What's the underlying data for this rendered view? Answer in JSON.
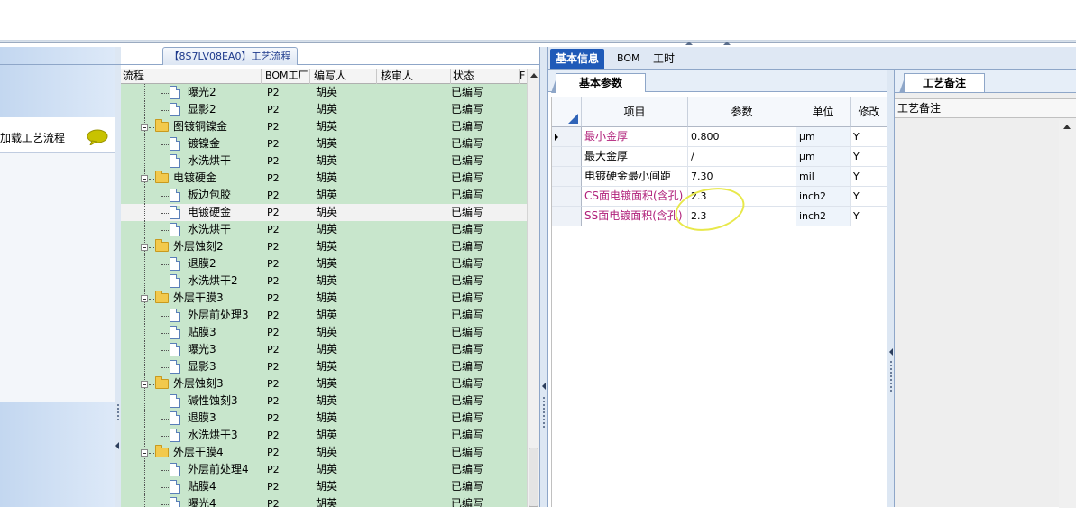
{
  "left_pane": {
    "load_flow_label": "加载工艺流程",
    "load_flow_icon": "speech-bubble-icon"
  },
  "process_tab": {
    "label": "【8S7LV08EA0】工艺流程"
  },
  "tree_grid": {
    "columns": [
      "流程",
      "BOM工厂",
      "编写人",
      "核审人",
      "状态",
      "F"
    ],
    "rows": [
      {
        "name": "曝光2",
        "type": "doc",
        "level": 2,
        "bom": "P2",
        "author": "胡英",
        "reviewer": "",
        "status": "已编写"
      },
      {
        "name": "显影2",
        "type": "doc",
        "level": 2,
        "bom": "P2",
        "author": "胡英",
        "reviewer": "",
        "status": "已编写"
      },
      {
        "name": "图镀铜镍金",
        "type": "folder",
        "level": 1,
        "bom": "P2",
        "author": "胡英",
        "reviewer": "",
        "status": "已编写"
      },
      {
        "name": "镀镍金",
        "type": "doc",
        "level": 2,
        "bom": "P2",
        "author": "胡英",
        "reviewer": "",
        "status": "已编写"
      },
      {
        "name": "水洗烘干",
        "type": "doc",
        "level": 2,
        "bom": "P2",
        "author": "胡英",
        "reviewer": "",
        "status": "已编写"
      },
      {
        "name": "电镀硬金",
        "type": "folder",
        "level": 1,
        "bom": "P2",
        "author": "胡英",
        "reviewer": "",
        "status": "已编写"
      },
      {
        "name": "板边包胶",
        "type": "doc",
        "level": 2,
        "bom": "P2",
        "author": "胡英",
        "reviewer": "",
        "status": "已编写"
      },
      {
        "name": "电镀硬金",
        "type": "doc",
        "level": 2,
        "bom": "P2",
        "author": "胡英",
        "reviewer": "",
        "status": "已编写",
        "selected": true
      },
      {
        "name": "水洗烘干",
        "type": "doc",
        "level": 2,
        "bom": "P2",
        "author": "胡英",
        "reviewer": "",
        "status": "已编写"
      },
      {
        "name": "外层蚀刻2",
        "type": "folder",
        "level": 1,
        "bom": "P2",
        "author": "胡英",
        "reviewer": "",
        "status": "已编写"
      },
      {
        "name": "退膜2",
        "type": "doc",
        "level": 2,
        "bom": "P2",
        "author": "胡英",
        "reviewer": "",
        "status": "已编写"
      },
      {
        "name": "水洗烘干2",
        "type": "doc",
        "level": 2,
        "bom": "P2",
        "author": "胡英",
        "reviewer": "",
        "status": "已编写"
      },
      {
        "name": "外层干膜3",
        "type": "folder",
        "level": 1,
        "bom": "P2",
        "author": "胡英",
        "reviewer": "",
        "status": "已编写"
      },
      {
        "name": "外层前处理3",
        "type": "doc",
        "level": 2,
        "bom": "P2",
        "author": "胡英",
        "reviewer": "",
        "status": "已编写"
      },
      {
        "name": "贴膜3",
        "type": "doc",
        "level": 2,
        "bom": "P2",
        "author": "胡英",
        "reviewer": "",
        "status": "已编写"
      },
      {
        "name": "曝光3",
        "type": "doc",
        "level": 2,
        "bom": "P2",
        "author": "胡英",
        "reviewer": "",
        "status": "已编写"
      },
      {
        "name": "显影3",
        "type": "doc",
        "level": 2,
        "bom": "P2",
        "author": "胡英",
        "reviewer": "",
        "status": "已编写"
      },
      {
        "name": "外层蚀刻3",
        "type": "folder",
        "level": 1,
        "bom": "P2",
        "author": "胡英",
        "reviewer": "",
        "status": "已编写"
      },
      {
        "name": "碱性蚀刻3",
        "type": "doc",
        "level": 2,
        "bom": "P2",
        "author": "胡英",
        "reviewer": "",
        "status": "已编写"
      },
      {
        "name": "退膜3",
        "type": "doc",
        "level": 2,
        "bom": "P2",
        "author": "胡英",
        "reviewer": "",
        "status": "已编写"
      },
      {
        "name": "水洗烘干3",
        "type": "doc",
        "level": 2,
        "bom": "P2",
        "author": "胡英",
        "reviewer": "",
        "status": "已编写"
      },
      {
        "name": "外层干膜4",
        "type": "folder",
        "level": 1,
        "bom": "P2",
        "author": "胡英",
        "reviewer": "",
        "status": "已编写"
      },
      {
        "name": "外层前处理4",
        "type": "doc",
        "level": 2,
        "bom": "P2",
        "author": "胡英",
        "reviewer": "",
        "status": "已编写"
      },
      {
        "name": "贴膜4",
        "type": "doc",
        "level": 2,
        "bom": "P2",
        "author": "胡英",
        "reviewer": "",
        "status": "已编写"
      },
      {
        "name": "曝光4",
        "type": "doc",
        "level": 2,
        "bom": "P2",
        "author": "胡英",
        "reviewer": "",
        "status": "已编写"
      }
    ]
  },
  "right_tabs": [
    "基本信息",
    "BOM",
    "工时"
  ],
  "params": {
    "subtab": "基本参数",
    "columns": [
      "项目",
      "参数",
      "单位",
      "修改"
    ],
    "rows": [
      {
        "item": "最小金厚",
        "param": "0.800",
        "unit": "μm",
        "mod": "Y",
        "highlight": true,
        "current": true
      },
      {
        "item": "最大金厚",
        "param": "/",
        "unit": "μm",
        "mod": "Y",
        "highlight": false
      },
      {
        "item": "电镀硬金最小间距",
        "param": "7.30",
        "unit": "mil",
        "mod": "Y",
        "highlight": false
      },
      {
        "item": "CS面电镀面积(含孔)",
        "param": "2.3",
        "unit": "inch2",
        "mod": "Y",
        "highlight": true
      },
      {
        "item": "SS面电镀面积(含孔)",
        "param": "2.3",
        "unit": "inch2",
        "mod": "Y",
        "highlight": true
      }
    ]
  },
  "notes": {
    "tab": "工艺备注",
    "header": "工艺备注"
  },
  "colors": {
    "tree_bg": "#c8e6cc",
    "active_tab": "#1f5ab8",
    "magenta_text": "#b0207a",
    "annotation_ellipse": "#e8e84a"
  }
}
